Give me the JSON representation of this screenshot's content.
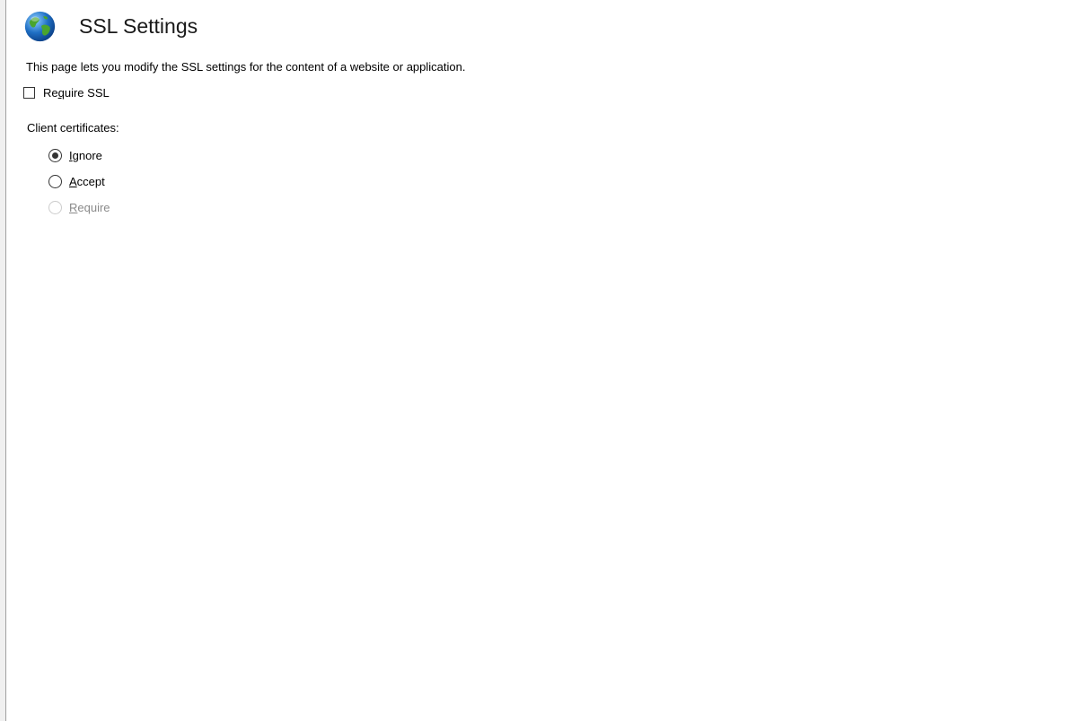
{
  "page": {
    "title": "SSL Settings",
    "icon": "globe-icon",
    "description": "This page lets you modify the SSL settings for the content of a website or application."
  },
  "require_ssl": {
    "label_pre": "Re",
    "label_mnemonic": "q",
    "label_post": "uire SSL",
    "checked": false
  },
  "client_certificates": {
    "label": "Client certificates:",
    "selected": "Ignore",
    "options": [
      {
        "mnemonic": "I",
        "rest": "gnore",
        "checked": true,
        "enabled": true
      },
      {
        "mnemonic": "A",
        "rest": "ccept",
        "checked": false,
        "enabled": true
      },
      {
        "mnemonic": "R",
        "rest": "equire",
        "checked": false,
        "enabled": false
      }
    ]
  },
  "colors": {
    "text": "#000000",
    "disabled_text": "#8a8a8a",
    "globe_blue": "#1f6fc4",
    "globe_green": "#4aa52e"
  }
}
